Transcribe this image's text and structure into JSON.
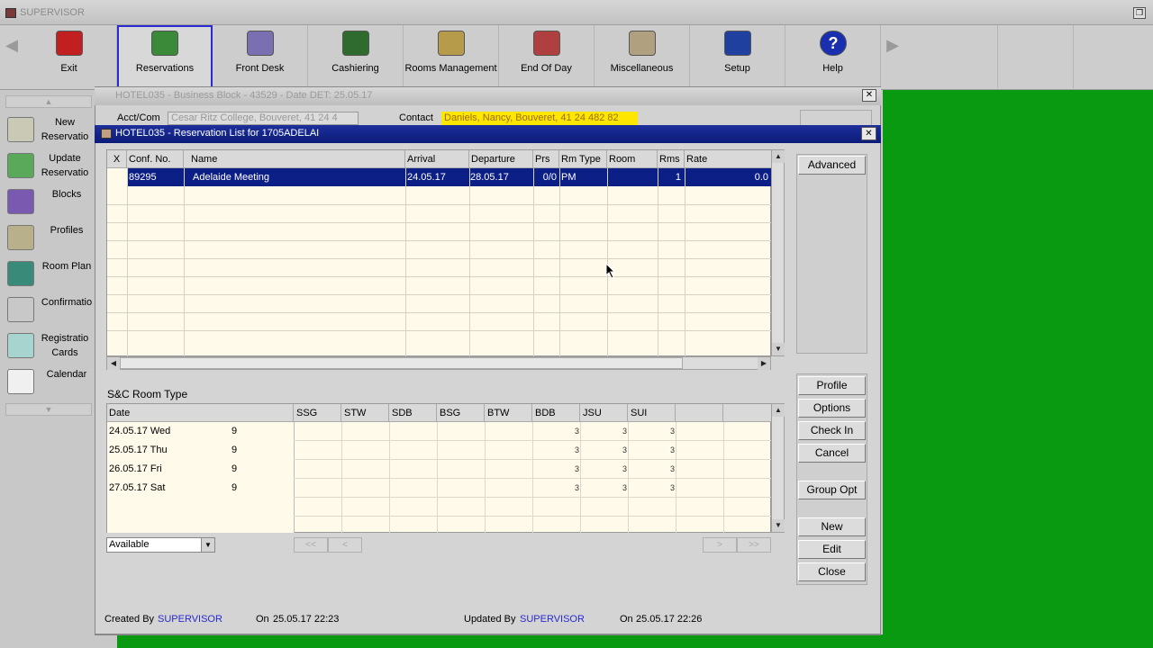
{
  "app": {
    "title": "SUPERVISOR",
    "restore_icon": "restore-icon"
  },
  "toolbar": {
    "items": [
      {
        "label": "Exit",
        "icon": "exit-door-icon",
        "color": "#c22020"
      },
      {
        "label": "Reservations",
        "icon": "reservations-icon",
        "color": "#3a8a3a"
      },
      {
        "label": "Front Desk",
        "icon": "front-desk-icon",
        "color": "#7a6fb0"
      },
      {
        "label": "Cashiering",
        "icon": "cashiering-icon",
        "color": "#2f6a2f"
      },
      {
        "label": "Rooms Management",
        "icon": "rooms-management-icon",
        "color": "#b59b4a"
      },
      {
        "label": "End Of Day",
        "icon": "end-of-day-icon",
        "color": "#b04040"
      },
      {
        "label": "Miscellaneous",
        "icon": "miscellaneous-icon",
        "color": "#b0a080"
      },
      {
        "label": "Setup",
        "icon": "setup-icon",
        "color": "#2040a0"
      },
      {
        "label": "Help",
        "icon": "help-icon",
        "color": "#1a2fb0"
      }
    ]
  },
  "sidebar": {
    "items": [
      {
        "label": "New Reservatio",
        "icon": "new-reservation-icon"
      },
      {
        "label": "Update Reservatio",
        "icon": "update-reservation-icon"
      },
      {
        "label": "Blocks",
        "icon": "blocks-icon"
      },
      {
        "label": "Profiles",
        "icon": "profiles-icon"
      },
      {
        "label": "Room Plan",
        "icon": "room-plan-icon"
      },
      {
        "label": "Confirmatio",
        "icon": "confirmation-icon"
      },
      {
        "label": "Registratio Cards",
        "icon": "registration-cards-icon"
      },
      {
        "label": "Calendar",
        "icon": "calendar-icon"
      }
    ]
  },
  "block_window": {
    "title": "HOTEL035 - Business Block - 43529 - Date DET: 25.05.17",
    "acct_label": "Acct/Com",
    "acct_value": "Cesar Ritz College, Bouveret, 41 24 4",
    "contact_label": "Contact",
    "contact_value": "Daniels, Nancy, Bouveret, 41 24 482 82"
  },
  "res_window": {
    "title": "HOTEL035 - Reservation List for 1705ADELAI",
    "columns": [
      "X",
      "Conf. No.",
      "Name",
      "Arrival",
      "Departure",
      "Prs",
      "Rm Type",
      "Room",
      "Rms",
      "Rate"
    ],
    "rows": [
      {
        "conf": "89295",
        "name": "Adelaide Meeting",
        "arrival": "24.05.17",
        "departure": "28.05.17",
        "prs": "0/0",
        "rmtype": "PM",
        "room": "",
        "rms": "1",
        "rate": "0.0"
      }
    ]
  },
  "buttons": {
    "advanced": "Advanced",
    "profile": "Profile",
    "options": "Options",
    "check_in": "Check In",
    "cancel": "Cancel",
    "group_opt": "Group Opt",
    "new": "New",
    "edit": "Edit",
    "close": "Close"
  },
  "snc": {
    "label": "S&C Room Type",
    "date_header": "Date",
    "room_types": [
      "SSG",
      "STW",
      "SDB",
      "BSG",
      "BTW",
      "BDB",
      "JSU",
      "SUI",
      ""
    ],
    "rows": [
      {
        "date": "24.05.17 Wed",
        "count": "9",
        "bdb": "3",
        "jsu": "3",
        "sui": "3"
      },
      {
        "date": "25.05.17 Thu",
        "count": "9",
        "bdb": "3",
        "jsu": "3",
        "sui": "3"
      },
      {
        "date": "26.05.17 Fri",
        "count": "9",
        "bdb": "3",
        "jsu": "3",
        "sui": "3"
      },
      {
        "date": "27.05.17 Sat",
        "count": "9",
        "bdb": "3",
        "jsu": "3",
        "sui": "3"
      }
    ],
    "availability": "Available",
    "nav_first": "<<",
    "nav_prev": "<",
    "nav_next": ">",
    "nav_last": ">>"
  },
  "footer": {
    "created_by_label": "Created By",
    "created_by": "SUPERVISOR",
    "created_on_label": "On",
    "created_on": "25.05.17 22:23",
    "updated_by_label": "Updated By",
    "updated_by": "SUPERVISOR",
    "updated_on_label": "On",
    "updated_on": "25.05.17 22:26"
  },
  "colors": {
    "desktop": "#0a9a12",
    "selection": "#0c1f86",
    "highlight": "#ffe600"
  }
}
